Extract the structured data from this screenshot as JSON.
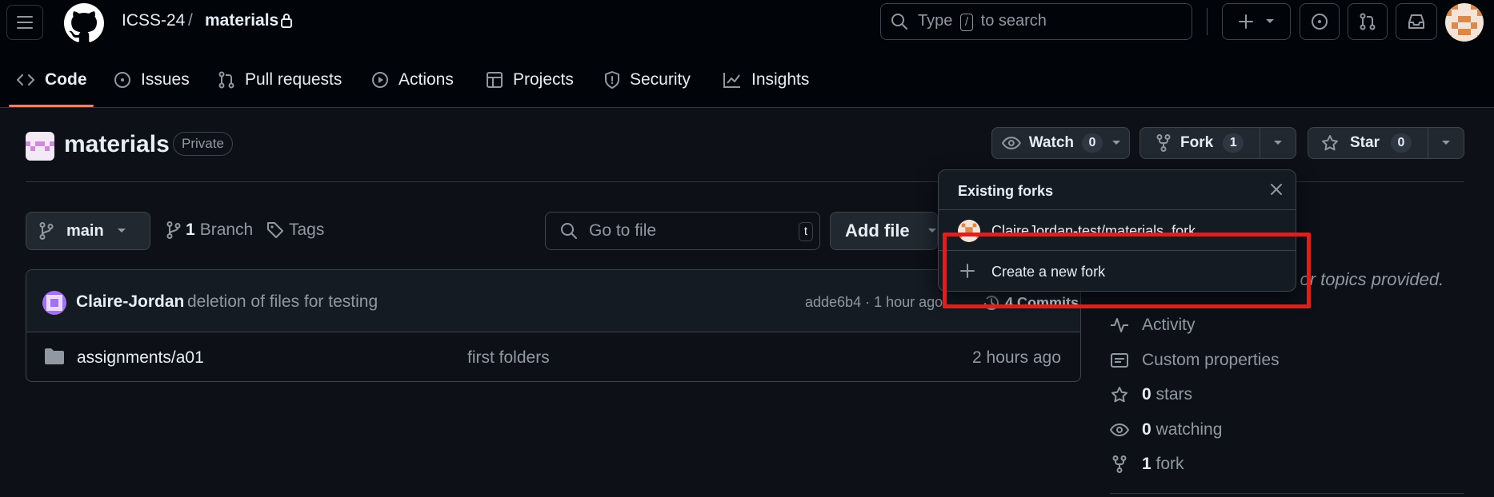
{
  "header": {
    "owner": "ICSS-24",
    "separator": "/",
    "repo": "materials",
    "search_prefix": "Type",
    "search_key": "/",
    "search_suffix": "to search"
  },
  "tabs": [
    {
      "label": "Code",
      "icon": "code-icon",
      "active": true
    },
    {
      "label": "Issues",
      "icon": "issue-icon"
    },
    {
      "label": "Pull requests",
      "icon": "pull-request-icon"
    },
    {
      "label": "Actions",
      "icon": "play-icon"
    },
    {
      "label": "Projects",
      "icon": "table-icon"
    },
    {
      "label": "Security",
      "icon": "shield-icon"
    },
    {
      "label": "Insights",
      "icon": "graph-icon"
    }
  ],
  "repo": {
    "title": "materials",
    "visibility": "Private",
    "watch_label": "Watch",
    "watch_count": "0",
    "fork_label": "Fork",
    "fork_count": "1",
    "star_label": "Star",
    "star_count": "0"
  },
  "toolbar": {
    "branch": "main",
    "branch_count": "1",
    "branch_label": "Branch",
    "tags_label": "Tags",
    "go_to_file": "Go to file",
    "go_to_file_key": "t",
    "add_file": "Add file"
  },
  "latest_commit": {
    "author": "Claire-Jordan",
    "message": "deletion of files for testing",
    "meta": "adde6b4 · 1 hour ago",
    "commits_label": "4 Commits"
  },
  "files": [
    {
      "name": "assignments/a01",
      "message": "first folders",
      "time": "2 hours ago",
      "icon": "folder-icon"
    }
  ],
  "sidebar": {
    "about_fragment": "e, or topics provided.",
    "activity": "Activity",
    "custom_properties": "Custom properties",
    "stars_count": "0",
    "stars_label": "stars",
    "watching_count": "0",
    "watching_label": "watching",
    "forks_count": "1",
    "forks_label": "fork"
  },
  "fork_menu": {
    "title": "Existing forks",
    "existing_fork": "ClaireJordan-test/materials_fork",
    "create_label": "Create a new fork"
  },
  "colors": {
    "background": "#0d1117",
    "header_bg": "#010409",
    "accent_underline": "#f78166",
    "highlight": "#e01e1e"
  }
}
